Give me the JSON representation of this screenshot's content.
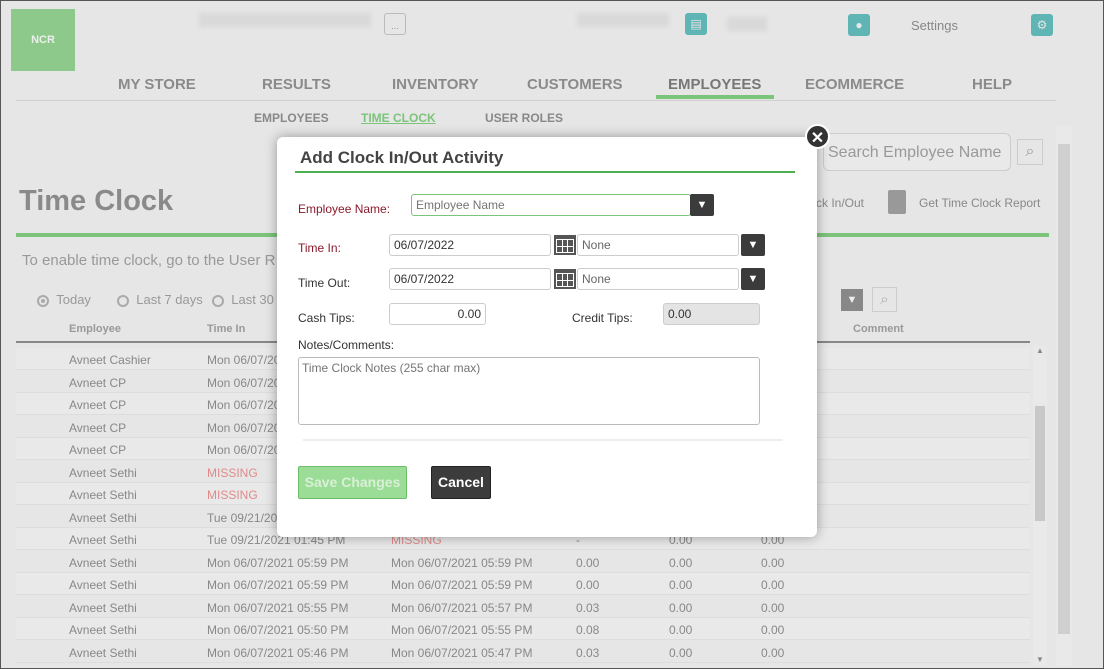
{
  "header": {
    "logo_text": "NCR",
    "more_label": "...",
    "settings_label": "Settings",
    "store_icon": "store-icon",
    "user_icon": "user-icon",
    "gear_icon": "gear-icon"
  },
  "nav": {
    "items": [
      {
        "label": "MY STORE"
      },
      {
        "label": "RESULTS"
      },
      {
        "label": "INVENTORY"
      },
      {
        "label": "CUSTOMERS"
      },
      {
        "label": "EMPLOYEES",
        "active": true
      },
      {
        "label": "ECOMMERCE"
      },
      {
        "label": "HELP"
      }
    ],
    "accent": "#7cc47a"
  },
  "subnav": {
    "items": [
      {
        "label": "EMPLOYEES"
      },
      {
        "label": "TIME CLOCK",
        "active": true
      },
      {
        "label": "USER ROLES"
      }
    ]
  },
  "page": {
    "title": "Time Clock",
    "info": "To enable time clock, go to the User R",
    "search_placeholder": "Search Employee Name",
    "clock_link": "ck In/Out",
    "report_link": "Get Time Clock Report"
  },
  "filters": {
    "options": [
      {
        "label": "Today",
        "selected": true
      },
      {
        "label": "Last 7 days"
      },
      {
        "label": "Last 30"
      }
    ]
  },
  "table": {
    "headers": {
      "employee": "Employee",
      "time_in": "Time In",
      "comment": "Comment"
    },
    "rows": [
      {
        "employee": "Avneet Cashier",
        "time_in": "Mon 06/07/20"
      },
      {
        "employee": "Avneet CP",
        "time_in": "Mon 06/07/20"
      },
      {
        "employee": "Avneet CP",
        "time_in": "Mon 06/07/20"
      },
      {
        "employee": "Avneet CP",
        "time_in": "Mon 06/07/20"
      },
      {
        "employee": "Avneet CP",
        "time_in": "Mon 06/07/20"
      },
      {
        "employee": "Avneet Sethi",
        "time_in": "MISSING",
        "missing_in": true
      },
      {
        "employee": "Avneet Sethi",
        "time_in": "MISSING",
        "missing_in": true
      },
      {
        "employee": "Avneet Sethi",
        "time_in": "Tue 09/21/20"
      },
      {
        "employee": "Avneet Sethi",
        "time_in": "Tue 09/21/2021 01:45 PM",
        "time_out": "MISSING",
        "missing_out": true,
        "hours": "-",
        "c1": "0.00",
        "c2": "0.00"
      },
      {
        "employee": "Avneet Sethi",
        "time_in": "Mon 06/07/2021 05:59 PM",
        "time_out": "Mon 06/07/2021 05:59 PM",
        "hours": "0.00",
        "c1": "0.00",
        "c2": "0.00"
      },
      {
        "employee": "Avneet Sethi",
        "time_in": "Mon 06/07/2021 05:59 PM",
        "time_out": "Mon 06/07/2021 05:59 PM",
        "hours": "0.00",
        "c1": "0.00",
        "c2": "0.00"
      },
      {
        "employee": "Avneet Sethi",
        "time_in": "Mon 06/07/2021 05:55 PM",
        "time_out": "Mon 06/07/2021 05:57 PM",
        "hours": "0.03",
        "c1": "0.00",
        "c2": "0.00"
      },
      {
        "employee": "Avneet Sethi",
        "time_in": "Mon 06/07/2021 05:50 PM",
        "time_out": "Mon 06/07/2021 05:55 PM",
        "hours": "0.08",
        "c1": "0.00",
        "c2": "0.00"
      },
      {
        "employee": "Avneet Sethi",
        "time_in": "Mon 06/07/2021 05:46 PM",
        "time_out": "Mon 06/07/2021 05:47 PM",
        "hours": "0.03",
        "c1": "0.00",
        "c2": "0.00"
      }
    ]
  },
  "dialog": {
    "title": "Add Clock In/Out Activity",
    "employee_label": "Employee Name:",
    "employee_placeholder": "Employee Name",
    "time_in_label": "Time In:",
    "time_in_date": "06/07/2022",
    "time_in_time": "None",
    "time_out_label": "Time Out:",
    "time_out_date": "06/07/2022",
    "time_out_time": "None",
    "cash_tips_label": "Cash Tips:",
    "cash_tips": "0.00",
    "credit_tips_label": "Credit Tips:",
    "credit_tips": "0.00",
    "notes_label": "Notes/Comments:",
    "notes_placeholder": "Time Clock Notes (255 char max)",
    "save_label": "Save Changes",
    "cancel_label": "Cancel"
  }
}
